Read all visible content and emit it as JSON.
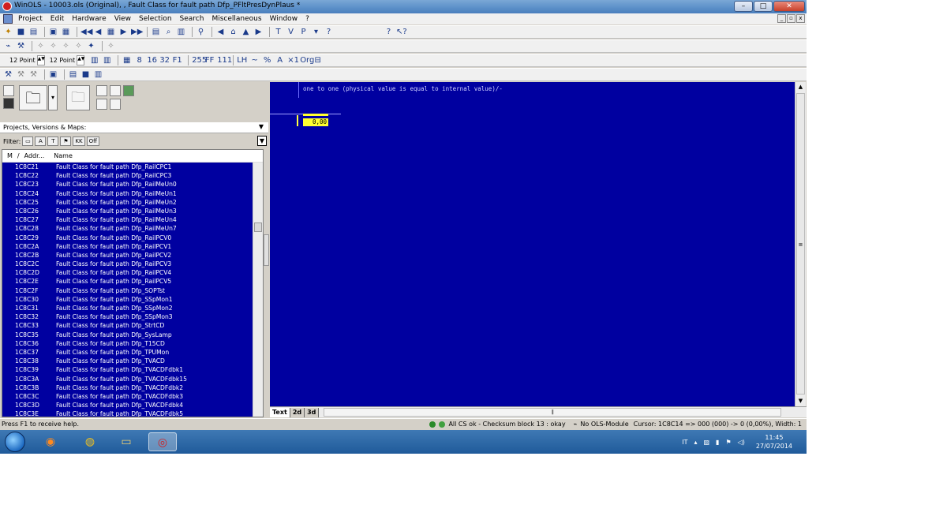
{
  "window": {
    "title": "WinOLS - 10003.ols (Original), , Fault Class for fault path Dfp_PFltPresDynPlaus *",
    "min": "–",
    "max": "□",
    "close": "✕"
  },
  "menu": {
    "items": [
      "Project",
      "Edit",
      "Hardware",
      "View",
      "Selection",
      "Search",
      "Miscellaneous",
      "Window",
      "?"
    ],
    "mdi": [
      "_",
      "▫",
      "x"
    ]
  },
  "toolbar3": {
    "font1": "12 Point",
    "font2": "12 Point"
  },
  "left": {
    "combo": "Projects, Versions & Maps:",
    "filter_label": "Filter:",
    "filter_off": "Off",
    "headers": [
      "M",
      "/",
      "Addr...",
      "Name"
    ],
    "rows": [
      {
        "addr": "1C8C21",
        "name": "Fault Class for fault path Dfp_RailCPC1"
      },
      {
        "addr": "1C8C22",
        "name": "Fault Class for fault path Dfp_RailCPC3"
      },
      {
        "addr": "1C8C23",
        "name": "Fault Class for fault path Dfp_RailMeUn0"
      },
      {
        "addr": "1C8C24",
        "name": "Fault Class for fault path Dfp_RailMeUn1"
      },
      {
        "addr": "1C8C25",
        "name": "Fault Class for fault path Dfp_RailMeUn2"
      },
      {
        "addr": "1C8C26",
        "name": "Fault Class for fault path Dfp_RailMeUn3"
      },
      {
        "addr": "1C8C27",
        "name": "Fault Class for fault path Dfp_RailMeUn4"
      },
      {
        "addr": "1C8C28",
        "name": "Fault Class for fault path Dfp_RailMeUn7"
      },
      {
        "addr": "1C8C29",
        "name": "Fault Class for fault path Dfp_RailPCV0"
      },
      {
        "addr": "1C8C2A",
        "name": "Fault Class for fault path Dfp_RailPCV1"
      },
      {
        "addr": "1C8C2B",
        "name": "Fault Class for fault path Dfp_RailPCV2"
      },
      {
        "addr": "1C8C2C",
        "name": "Fault Class for fault path Dfp_RailPCV3"
      },
      {
        "addr": "1C8C2D",
        "name": "Fault Class for fault path Dfp_RailPCV4"
      },
      {
        "addr": "1C8C2E",
        "name": "Fault Class for fault path Dfp_RailPCV5"
      },
      {
        "addr": "1C8C2F",
        "name": "Fault Class for fault path Dfp_SOPTst"
      },
      {
        "addr": "1C8C30",
        "name": "Fault Class for fault path Dfp_SSpMon1"
      },
      {
        "addr": "1C8C31",
        "name": "Fault Class for fault path Dfp_SSpMon2"
      },
      {
        "addr": "1C8C32",
        "name": "Fault Class for fault path Dfp_SSpMon3"
      },
      {
        "addr": "1C8C33",
        "name": "Fault Class for fault path Dfp_StrtCD"
      },
      {
        "addr": "1C8C35",
        "name": "Fault Class for fault path Dfp_SysLamp"
      },
      {
        "addr": "1C8C36",
        "name": "Fault Class for fault path Dfp_T15CD"
      },
      {
        "addr": "1C8C37",
        "name": "Fault Class for fault path Dfp_TPUMon"
      },
      {
        "addr": "1C8C38",
        "name": "Fault Class for fault path Dfp_TVACD"
      },
      {
        "addr": "1C8C39",
        "name": "Fault Class for fault path Dfp_TVACDFdbk1"
      },
      {
        "addr": "1C8C3A",
        "name": "Fault Class for fault path Dfp_TVACDFdbk15"
      },
      {
        "addr": "1C8C3B",
        "name": "Fault Class for fault path Dfp_TVACDFdbk2"
      },
      {
        "addr": "1C8C3C",
        "name": "Fault Class for fault path Dfp_TVACDFdbk3"
      },
      {
        "addr": "1C8C3D",
        "name": "Fault Class for fault path Dfp_TVACDFdbk4"
      },
      {
        "addr": "1C8C3E",
        "name": "Fault Class for fault path Dfp_TVACDFdbk5"
      }
    ]
  },
  "editor": {
    "description": "one to one (physical value is equal to internal value)/-",
    "cell_value": "0,00",
    "tabs": [
      "Text",
      "2d",
      "3d"
    ]
  },
  "status": {
    "help": "Press F1 to receive help.",
    "checksum": "All CS ok - Checksum block 13 : okay",
    "module": "No OLS-Module",
    "cursor": "Cursor: 1C8C14 => 000 (000) -> 0 (0,00%), Width: 1"
  },
  "taskbar": {
    "lang": "IT",
    "time": "11:45",
    "date": "27/07/2014"
  },
  "colors": {
    "editor_bg": "#0000a0",
    "selection": "#0000a0",
    "cell_highlight": "#ffff30"
  }
}
